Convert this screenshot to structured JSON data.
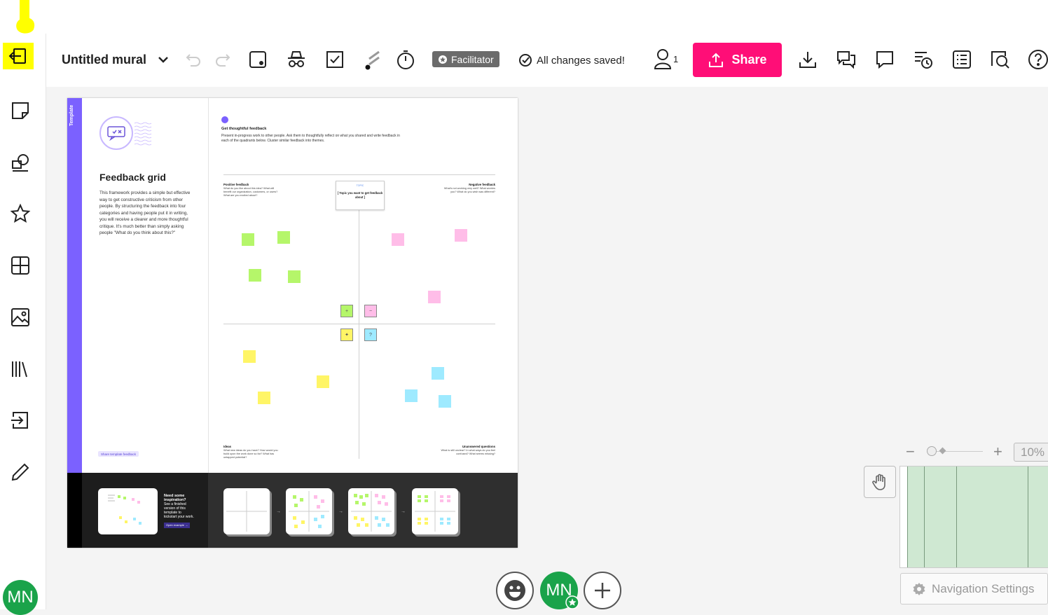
{
  "toolbar": {
    "title": "Untitled mural",
    "facilitator_label": "Facilitator",
    "save_status": "All changes saved!",
    "user_count": "1",
    "share_label": "Share"
  },
  "board": {
    "side_tag": "Template",
    "title": "Feedback grid",
    "description": "This framework provides a simple but effective way to get constructive criticism from other people. By structuring the feedback into four categories and having people put it in writing, you will receive a clearer and more thoughtful critique. It's much better than simply asking people \"What do you think about this?\"",
    "share_feedback": "Share template feedback",
    "heading": "Get thoughtful feedback",
    "heading_desc": "Present in-progress work to other people. Ask them to thoughtfully reflect on what you shared and write feedback in each of the quadrants below. Cluster similar feedback into themes.",
    "topic_head": "TOPIC",
    "topic_body": "[ Topic you want to get feedback about ]",
    "q_positive_title": "Positive feedback",
    "q_positive_text": "What do you like about this idea? What will benefit our organization, customers, or users? What are you excited about?",
    "q_negative_title": "Negative feedback",
    "q_negative_text": "What's not working very well? What worries you? What do you wish was different?",
    "q_ideas_title": "Ideas",
    "q_ideas_text": "What new ideas do you have? How would you build upon the work done so far? What has untapped potential?",
    "q_questions_title": "Unanswered questions",
    "q_questions_text": "What is still unclear? In what ways do you feel confused? What seems missing?",
    "need_title": "Need some inspiration?",
    "need_text": "See a finished version of this template to kickstart your work.",
    "need_btn": "Open example →"
  },
  "zoom": {
    "minus": "−",
    "plus": "+",
    "level": "10%"
  },
  "nav_settings_label": "Navigation Settings",
  "avatar_initials": "MN",
  "colors": {
    "share": "#ff0e77",
    "purple": "#7b61ff",
    "green_sticky": "#b5f66a",
    "pink_sticky": "#ffbde8",
    "yellow_sticky": "#fff566",
    "blue_sticky": "#9eeaff",
    "avatar": "#1aa34a"
  }
}
